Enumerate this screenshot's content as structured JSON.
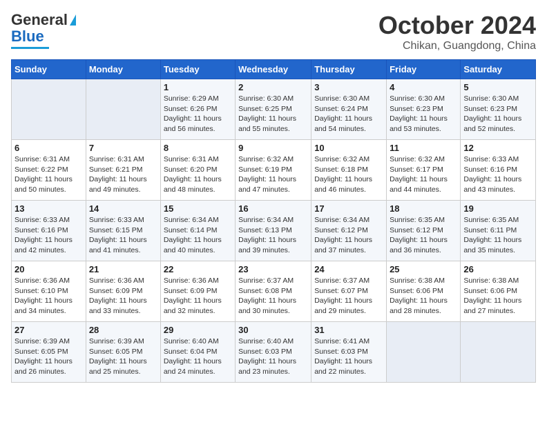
{
  "header": {
    "logo_line1": "General",
    "logo_line2": "Blue",
    "title": "October 2024",
    "location": "Chikan, Guangdong, China"
  },
  "weekdays": [
    "Sunday",
    "Monday",
    "Tuesday",
    "Wednesday",
    "Thursday",
    "Friday",
    "Saturday"
  ],
  "weeks": [
    [
      {
        "num": "",
        "info": ""
      },
      {
        "num": "",
        "info": ""
      },
      {
        "num": "1",
        "info": "Sunrise: 6:29 AM\nSunset: 6:26 PM\nDaylight: 11 hours and 56 minutes."
      },
      {
        "num": "2",
        "info": "Sunrise: 6:30 AM\nSunset: 6:25 PM\nDaylight: 11 hours and 55 minutes."
      },
      {
        "num": "3",
        "info": "Sunrise: 6:30 AM\nSunset: 6:24 PM\nDaylight: 11 hours and 54 minutes."
      },
      {
        "num": "4",
        "info": "Sunrise: 6:30 AM\nSunset: 6:23 PM\nDaylight: 11 hours and 53 minutes."
      },
      {
        "num": "5",
        "info": "Sunrise: 6:30 AM\nSunset: 6:23 PM\nDaylight: 11 hours and 52 minutes."
      }
    ],
    [
      {
        "num": "6",
        "info": "Sunrise: 6:31 AM\nSunset: 6:22 PM\nDaylight: 11 hours and 50 minutes."
      },
      {
        "num": "7",
        "info": "Sunrise: 6:31 AM\nSunset: 6:21 PM\nDaylight: 11 hours and 49 minutes."
      },
      {
        "num": "8",
        "info": "Sunrise: 6:31 AM\nSunset: 6:20 PM\nDaylight: 11 hours and 48 minutes."
      },
      {
        "num": "9",
        "info": "Sunrise: 6:32 AM\nSunset: 6:19 PM\nDaylight: 11 hours and 47 minutes."
      },
      {
        "num": "10",
        "info": "Sunrise: 6:32 AM\nSunset: 6:18 PM\nDaylight: 11 hours and 46 minutes."
      },
      {
        "num": "11",
        "info": "Sunrise: 6:32 AM\nSunset: 6:17 PM\nDaylight: 11 hours and 44 minutes."
      },
      {
        "num": "12",
        "info": "Sunrise: 6:33 AM\nSunset: 6:16 PM\nDaylight: 11 hours and 43 minutes."
      }
    ],
    [
      {
        "num": "13",
        "info": "Sunrise: 6:33 AM\nSunset: 6:16 PM\nDaylight: 11 hours and 42 minutes."
      },
      {
        "num": "14",
        "info": "Sunrise: 6:33 AM\nSunset: 6:15 PM\nDaylight: 11 hours and 41 minutes."
      },
      {
        "num": "15",
        "info": "Sunrise: 6:34 AM\nSunset: 6:14 PM\nDaylight: 11 hours and 40 minutes."
      },
      {
        "num": "16",
        "info": "Sunrise: 6:34 AM\nSunset: 6:13 PM\nDaylight: 11 hours and 39 minutes."
      },
      {
        "num": "17",
        "info": "Sunrise: 6:34 AM\nSunset: 6:12 PM\nDaylight: 11 hours and 37 minutes."
      },
      {
        "num": "18",
        "info": "Sunrise: 6:35 AM\nSunset: 6:12 PM\nDaylight: 11 hours and 36 minutes."
      },
      {
        "num": "19",
        "info": "Sunrise: 6:35 AM\nSunset: 6:11 PM\nDaylight: 11 hours and 35 minutes."
      }
    ],
    [
      {
        "num": "20",
        "info": "Sunrise: 6:36 AM\nSunset: 6:10 PM\nDaylight: 11 hours and 34 minutes."
      },
      {
        "num": "21",
        "info": "Sunrise: 6:36 AM\nSunset: 6:09 PM\nDaylight: 11 hours and 33 minutes."
      },
      {
        "num": "22",
        "info": "Sunrise: 6:36 AM\nSunset: 6:09 PM\nDaylight: 11 hours and 32 minutes."
      },
      {
        "num": "23",
        "info": "Sunrise: 6:37 AM\nSunset: 6:08 PM\nDaylight: 11 hours and 30 minutes."
      },
      {
        "num": "24",
        "info": "Sunrise: 6:37 AM\nSunset: 6:07 PM\nDaylight: 11 hours and 29 minutes."
      },
      {
        "num": "25",
        "info": "Sunrise: 6:38 AM\nSunset: 6:06 PM\nDaylight: 11 hours and 28 minutes."
      },
      {
        "num": "26",
        "info": "Sunrise: 6:38 AM\nSunset: 6:06 PM\nDaylight: 11 hours and 27 minutes."
      }
    ],
    [
      {
        "num": "27",
        "info": "Sunrise: 6:39 AM\nSunset: 6:05 PM\nDaylight: 11 hours and 26 minutes."
      },
      {
        "num": "28",
        "info": "Sunrise: 6:39 AM\nSunset: 6:05 PM\nDaylight: 11 hours and 25 minutes."
      },
      {
        "num": "29",
        "info": "Sunrise: 6:40 AM\nSunset: 6:04 PM\nDaylight: 11 hours and 24 minutes."
      },
      {
        "num": "30",
        "info": "Sunrise: 6:40 AM\nSunset: 6:03 PM\nDaylight: 11 hours and 23 minutes."
      },
      {
        "num": "31",
        "info": "Sunrise: 6:41 AM\nSunset: 6:03 PM\nDaylight: 11 hours and 22 minutes."
      },
      {
        "num": "",
        "info": ""
      },
      {
        "num": "",
        "info": ""
      }
    ]
  ]
}
